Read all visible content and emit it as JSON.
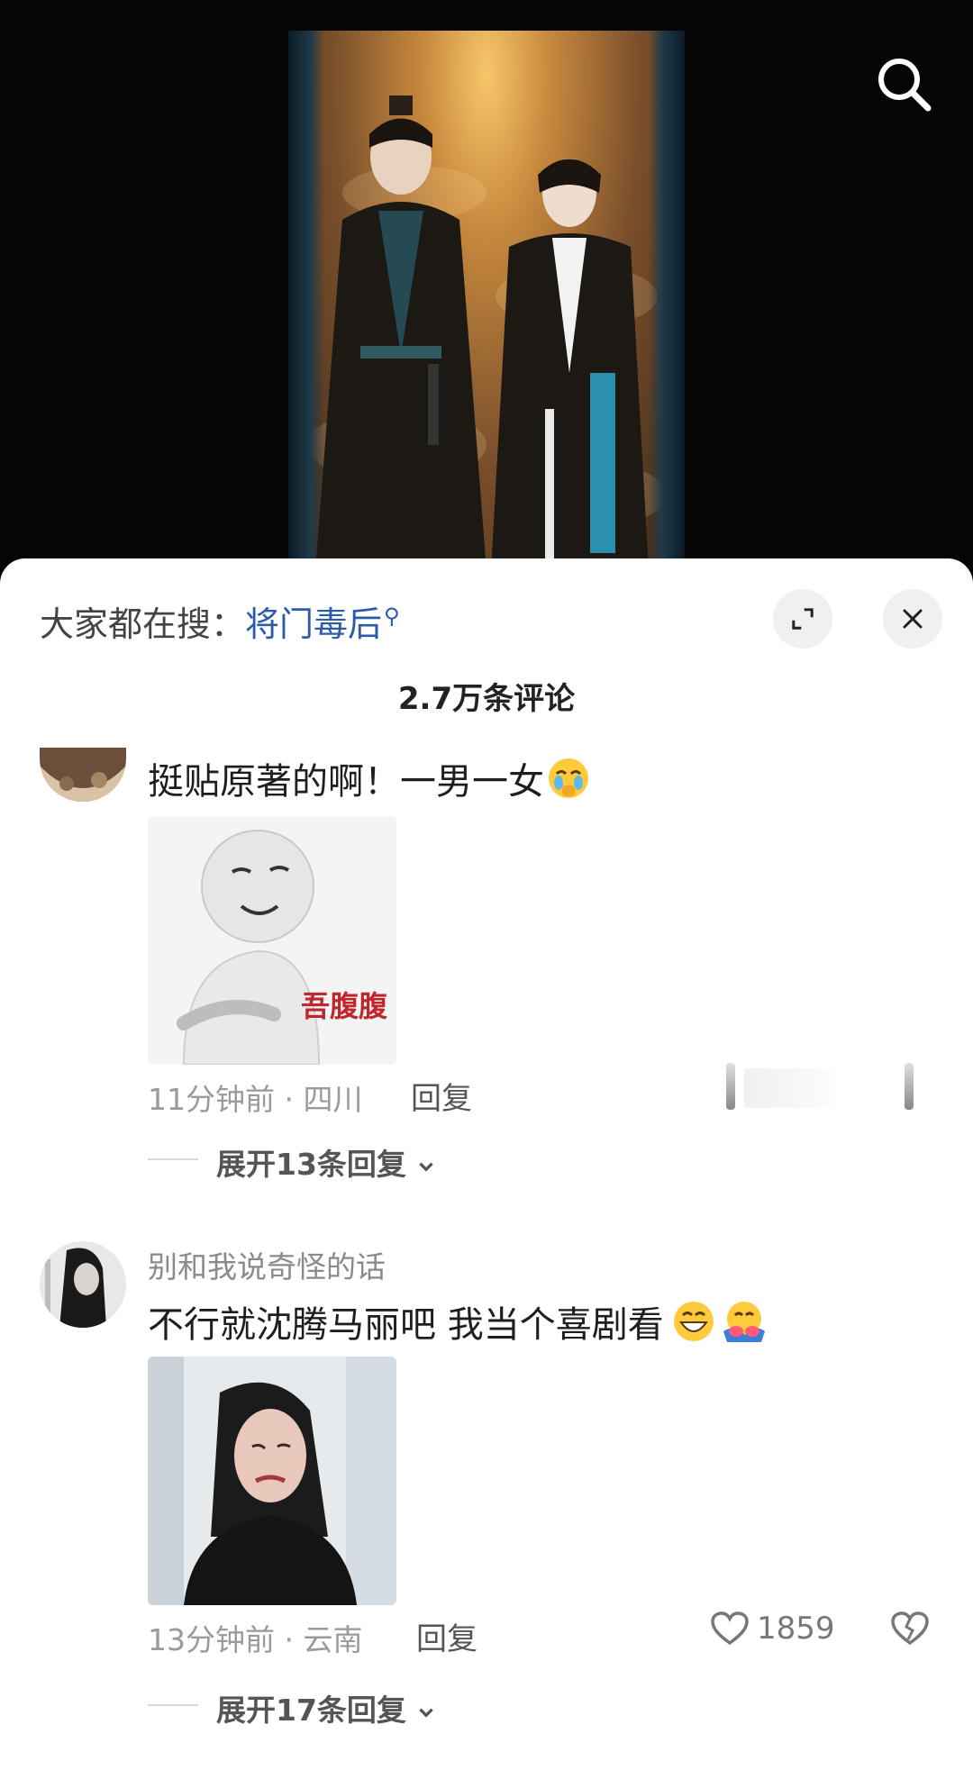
{
  "header": {
    "trending_prefix": "大家都在搜：",
    "trending_keyword": "将门毒后",
    "comment_count": "2.7万条评论"
  },
  "comments": [
    {
      "text": "挺贴原著的啊！一男一女",
      "sticker_caption": "吾腹腹",
      "time_location": "11分钟前 · 四川",
      "reply_label": "回复",
      "expand_label": "展开13条回复"
    },
    {
      "username": "别和我说奇怪的话",
      "text": "不行就沈腾马丽吧 我当个喜剧看",
      "time_location": "13分钟前 · 云南",
      "reply_label": "回复",
      "like_count": "1859",
      "expand_label": "展开17条回复"
    }
  ],
  "colors": {
    "link_blue": "#2a5ca8",
    "sheet_bg": "#ffffff",
    "muted_text": "#9a9a9a"
  }
}
